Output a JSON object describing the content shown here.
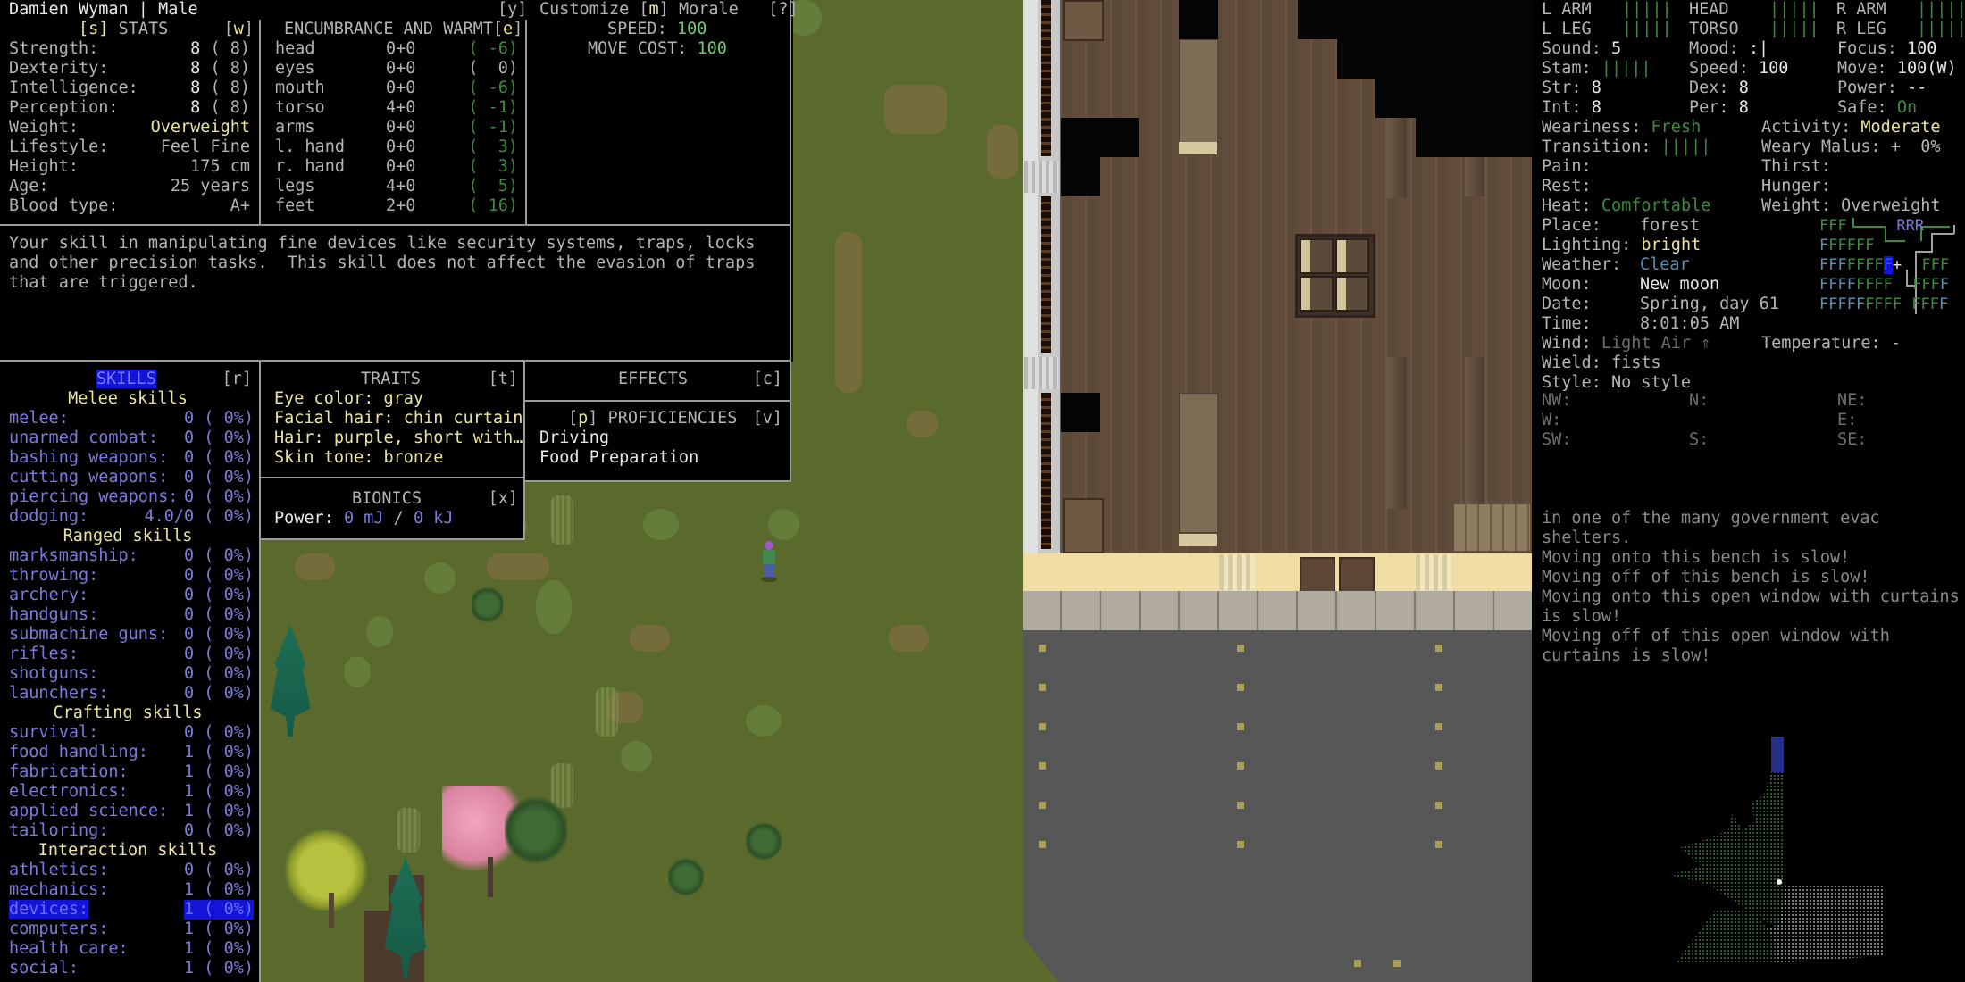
{
  "character": {
    "name_line": "Damien Wyman | Male"
  },
  "stats_panel": {
    "title": "[s] STATS",
    "hotkey": "[w]",
    "rows": [
      {
        "label": "Strength:",
        "value": "8",
        "base": "( 8)"
      },
      {
        "label": "Dexterity:",
        "value": "8",
        "base": "( 8)"
      },
      {
        "label": "Intelligence:",
        "value": "8",
        "base": "( 8)"
      },
      {
        "label": "Perception:",
        "value": "8",
        "base": "( 8)"
      },
      {
        "label": "Weight:",
        "value": "Overweight"
      },
      {
        "label": "Lifestyle:",
        "value": "Feel Fine"
      },
      {
        "label": "Height:",
        "value": "175 cm"
      },
      {
        "label": "Age:",
        "value": "25 years"
      },
      {
        "label": "Blood type:",
        "value": "A+"
      }
    ]
  },
  "encumbrance_panel": {
    "hotkey_top": "[y]",
    "title": "ENCUMBRANCE AND WARMT",
    "hotkey": "[e]",
    "rows": [
      {
        "part": "head",
        "enc": "0+0",
        "warmth": "( -6)"
      },
      {
        "part": "eyes",
        "enc": "0+0",
        "warmth": "(  0)"
      },
      {
        "part": "mouth",
        "enc": "0+0",
        "warmth": "( -6)"
      },
      {
        "part": "torso",
        "enc": "4+0",
        "warmth": "( -1)"
      },
      {
        "part": "arms",
        "enc": "0+0",
        "warmth": "( -1)"
      },
      {
        "part": "l. hand",
        "enc": "0+0",
        "warmth": "(  3)"
      },
      {
        "part": "r. hand",
        "enc": "0+0",
        "warmth": "(  3)"
      },
      {
        "part": "legs",
        "enc": "4+0",
        "warmth": "(  5)"
      },
      {
        "part": "feet",
        "enc": "2+0",
        "warmth": "( 16)"
      }
    ]
  },
  "speed_panel": {
    "header": "] Customize [m] Morale   [?]",
    "customize": "Customize",
    "morale_key": "[m]",
    "morale": "Morale",
    "help": "[?]",
    "speed_label": "SPEED:",
    "speed_value": "100",
    "move_label": "MOVE COST:",
    "move_value": "100"
  },
  "description": {
    "lines": [
      "Your skill in manipulating fine devices like security systems, traps, locks",
      "and other precision tasks.  This skill does not affect the evasion of traps",
      "that are triggered."
    ]
  },
  "skills_panel": {
    "title": "SKILLS",
    "hotkey": "[r]",
    "groups": [
      {
        "name": "Melee skills",
        "skills": [
          {
            "name": "melee:",
            "level": "0",
            "pct": "( 0%)"
          },
          {
            "name": "unarmed combat:",
            "level": "0",
            "pct": "( 0%)"
          },
          {
            "name": "bashing weapons:",
            "level": "0",
            "pct": "( 0%)"
          },
          {
            "name": "cutting weapons:",
            "level": "0",
            "pct": "( 0%)"
          },
          {
            "name": "piercing weapons:",
            "level": "0",
            "pct": "( 0%)"
          },
          {
            "name": "dodging:",
            "level": "4.0/0",
            "pct": "( 0%)"
          }
        ]
      },
      {
        "name": "Ranged skills",
        "skills": [
          {
            "name": "marksmanship:",
            "level": "0",
            "pct": "( 0%)"
          },
          {
            "name": "throwing:",
            "level": "0",
            "pct": "( 0%)"
          },
          {
            "name": "archery:",
            "level": "0",
            "pct": "( 0%)"
          },
          {
            "name": "handguns:",
            "level": "0",
            "pct": "( 0%)"
          },
          {
            "name": "submachine guns:",
            "level": "0",
            "pct": "( 0%)"
          },
          {
            "name": "rifles:",
            "level": "0",
            "pct": "( 0%)"
          },
          {
            "name": "shotguns:",
            "level": "0",
            "pct": "( 0%)"
          },
          {
            "name": "launchers:",
            "level": "0",
            "pct": "( 0%)"
          }
        ]
      },
      {
        "name": "Crafting skills",
        "skills": [
          {
            "name": "survival:",
            "level": "0",
            "pct": "( 0%)"
          },
          {
            "name": "food handling:",
            "level": "1",
            "pct": "( 0%)"
          },
          {
            "name": "fabrication:",
            "level": "1",
            "pct": "( 0%)"
          },
          {
            "name": "electronics:",
            "level": "1",
            "pct": "( 0%)"
          },
          {
            "name": "applied science:",
            "level": "1",
            "pct": "( 0%)"
          },
          {
            "name": "tailoring:",
            "level": "0",
            "pct": "( 0%)"
          }
        ]
      },
      {
        "name": "Interaction skills",
        "skills": [
          {
            "name": "athletics:",
            "level": "0",
            "pct": "( 0%)"
          },
          {
            "name": "mechanics:",
            "level": "1",
            "pct": "( 0%)"
          },
          {
            "name": "devices:",
            "level": "1",
            "pct": "( 0%)",
            "selected": true
          },
          {
            "name": "computers:",
            "level": "1",
            "pct": "( 0%)"
          },
          {
            "name": "health care:",
            "level": "1",
            "pct": "( 0%)"
          },
          {
            "name": "social:",
            "level": "1",
            "pct": "( 0%)"
          }
        ]
      }
    ]
  },
  "traits_panel": {
    "title": "TRAITS",
    "hotkey": "[t]",
    "items": [
      "Eye color: gray",
      "Facial hair: chin curtain",
      "Hair: purple, short with…",
      "Skin tone: bronze"
    ]
  },
  "effects_panel": {
    "title": "EFFECTS",
    "hotkey": "[c]"
  },
  "proficiencies_panel": {
    "title": "[p] PROFICIENCIES",
    "hotkey": "[v]",
    "items": [
      "Driving",
      "Food Preparation"
    ]
  },
  "bionics_panel": {
    "title": "BIONICS",
    "hotkey": "[x]",
    "power_label": "Power:",
    "power_value": "0 mJ",
    "power_sep": "/",
    "power_max": "0 kJ"
  },
  "sidebar": {
    "body": [
      {
        "label": "L ARM",
        "bar": "|||||"
      },
      {
        "label": "HEAD",
        "bar": "|||||"
      },
      {
        "label": "R ARM",
        "bar": "|||||"
      },
      {
        "label": "L LEG",
        "bar": "|||||"
      },
      {
        "label": "TORSO",
        "bar": "|||||"
      },
      {
        "label": "R LEG",
        "bar": "|||||"
      }
    ],
    "sound_label": "Sound:",
    "sound": "5",
    "mood_label": "Mood:",
    "mood": ":|",
    "focus_label": "Focus:",
    "focus": "100",
    "stam_label": "Stam:",
    "stam": "|||||",
    "speed_label": "Speed:",
    "speed": "100",
    "move_label": "Move:",
    "move": "100(W)",
    "str_label": "Str:",
    "str": "8",
    "dex_label": "Dex:",
    "dex": "8",
    "power_label": "Power:",
    "power": "--",
    "int_label": "Int:",
    "int": "8",
    "per_label": "Per:",
    "per": "8",
    "safe_label": "Safe:",
    "safe": "On",
    "weariness_label": "Weariness:",
    "weariness": "Fresh",
    "activity_label": "Activity:",
    "activity": "Moderate",
    "transition_label": "Transition:",
    "transition": "|||||",
    "malus_label": "Weary Malus:",
    "malus": "+  0%",
    "pain_label": "Pain:",
    "thirst_label": "Thirst:",
    "rest_label": "Rest:",
    "hunger_label": "Hunger:",
    "heat_label": "Heat:",
    "heat": "Comfortable",
    "weight_label": "Weight:",
    "weight": "Overweight",
    "place_label": "Place:",
    "place": "forest",
    "lighting_label": "Lighting:",
    "lighting": "bright",
    "weather_label": "Weather:",
    "weather": "Clear",
    "moon_label": "Moon:",
    "moon": "New moon",
    "date_label": "Date:",
    "date": "Spring, day 61",
    "time_label": "Time:",
    "time": "8:01:05 AM",
    "wind_label": "Wind:",
    "wind": "Light Air ⇑",
    "temp_label": "Temperature:",
    "temp": "-",
    "wield_label": "Wield:",
    "wield": "fists",
    "style_label": "Style:",
    "style": "No style",
    "compass": {
      "nw": "NW:",
      "n": "N:",
      "ne": "NE:",
      "w": "W:",
      "e": "E:",
      "sw": "SW:",
      "s": "S:",
      "se": "SE:"
    },
    "overmap_rows": [
      "FFF     RRR",
      "FFFFFF",
      "FFFFFFF +  FFF",
      "FFFFFFFFF  FFFF",
      "FFFFFFFFF FFFF"
    ]
  },
  "messages": [
    "in one of the many government evac",
    "shelters.",
    "Moving onto this bench is slow!",
    "Moving off of this bench is slow!",
    "Moving onto this open window with curtains",
    "is slow!",
    "Moving off of this open window with",
    "curtains is slow!"
  ],
  "colors": {
    "panel_border": "#9a9a9a",
    "skill_text": "#7b7bdc",
    "skill_highlight": "#1414d8",
    "heading_yellow": "#e8e4a0",
    "good_green": "#6ecc6e",
    "warmth_green": "#3f8a3f",
    "grass": "#5b6b2d"
  }
}
